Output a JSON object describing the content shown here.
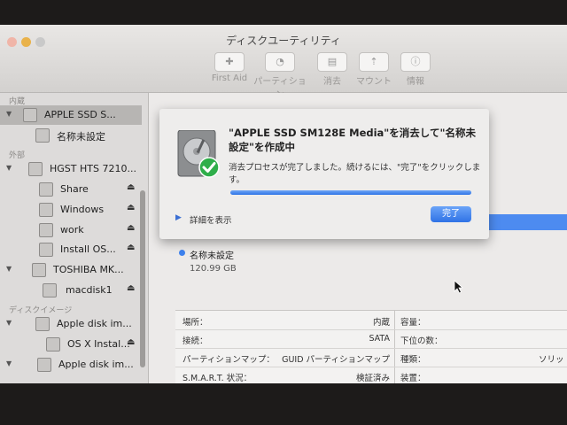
{
  "window": {
    "title": "ディスクユーティリティ"
  },
  "toolbar": {
    "buttons": [
      {
        "label": "First Aid",
        "icon": "stethoscope-icon",
        "glyph": "✚"
      },
      {
        "label": "パーティション",
        "icon": "pie-partition-icon",
        "glyph": "◔"
      },
      {
        "label": "消去",
        "icon": "erase-icon",
        "glyph": "▤"
      },
      {
        "label": "マウント",
        "icon": "mount-icon",
        "glyph": "⇡"
      },
      {
        "label": "情報",
        "icon": "info-icon",
        "glyph": "ⓘ"
      }
    ]
  },
  "sidebar": {
    "sections": {
      "internal": "内蔵",
      "external": "外部",
      "disk_images": "ディスクイメージ"
    },
    "items": [
      {
        "label": "APPLE SSD S...",
        "selected": true,
        "disclosure": true
      },
      {
        "label": "名称未設定"
      },
      {
        "label": "HGST HTS 7210...",
        "disclosure": true
      },
      {
        "label": "Share",
        "eject": "⏏"
      },
      {
        "label": "Windows",
        "eject": "⏏"
      },
      {
        "label": "work",
        "eject": "⏏"
      },
      {
        "label": "Install OS...",
        "eject": "⏏"
      },
      {
        "label": "TOSHIBA MK...",
        "disclosure": true
      },
      {
        "label": "macdisk1",
        "eject": "⏏"
      },
      {
        "label": "Apple disk im...",
        "disclosure": true
      },
      {
        "label": "OS X Instal...",
        "eject": "⏏"
      },
      {
        "label": "Apple disk im...",
        "disclosure": true
      }
    ]
  },
  "dialog": {
    "title": "\"APPLE SSD SM128E Media\"を消去して\"名称未設定\"を作成中",
    "message": "消去プロセスが完了しました。続けるには、\"完了\"をクリックします。",
    "progress": 1.0,
    "details_label": "詳細を表示",
    "done_label": "完了"
  },
  "volume": {
    "name": "名称未設定",
    "size": "120.99 GB"
  },
  "info": {
    "rows": [
      {
        "key": "場所：",
        "value": "内蔵",
        "key2": "容量：",
        "value2": ""
      },
      {
        "key": "接続：",
        "value": "SATA",
        "key2": "下位の数：",
        "value2": ""
      },
      {
        "key": "パーティションマップ：",
        "value": "GUID パーティションマップ",
        "key2": "種類：",
        "value2": "ソリッ"
      },
      {
        "key": "S.M.A.R.T. 状況：",
        "value": "検証済み",
        "key2": "装置：",
        "value2": ""
      }
    ]
  },
  "colors": {
    "accent": "#3e82ee",
    "selection": "#b7b5b3",
    "done_button": "#2f72e6"
  }
}
